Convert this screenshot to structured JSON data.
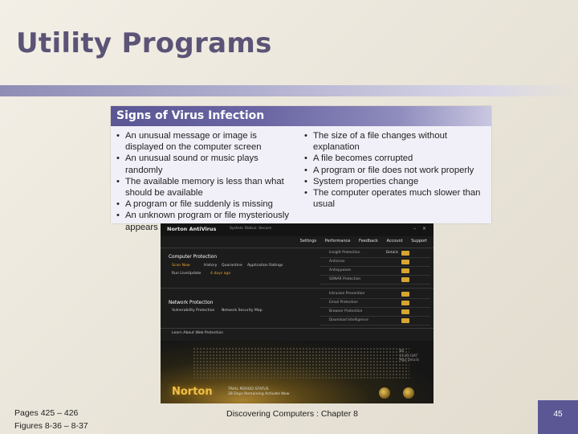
{
  "slide": {
    "title": "Utility Programs",
    "page_ref_line1": "Pages 425 – 426",
    "page_ref_line2": "Figures 8-36 – 8-37",
    "footer_center": "Discovering Computers : Chapter 8",
    "page_number": "45"
  },
  "virus_box": {
    "heading": "Signs of Virus Infection",
    "left_items": [
      "An unusual message or image is displayed on the computer screen",
      "An unusual sound or music plays randomly",
      "The available memory is less than what should be available",
      "A program or file suddenly is missing",
      "An unknown program or file mysteriously appears"
    ],
    "right_items": [
      "The size of a file changes without explanation",
      "A file becomes corrupted",
      "A program or file does not work properly",
      "System properties change",
      "The computer operates much slower than usual"
    ]
  },
  "norton": {
    "logo": "Norton AntiVirus",
    "status": "System Status: Secure",
    "menu": [
      "Settings",
      "Performance",
      "Feedback",
      "Account",
      "Support"
    ],
    "computer_protection": {
      "title": "Computer Protection",
      "links": [
        "Scan Now",
        "History",
        "Quarantine",
        "Application Ratings"
      ],
      "run_live_update": "Run LiveUpdate",
      "days_ago": "4 days ago",
      "rows": [
        "Insight Protection",
        "Antivirus",
        "Antispyware",
        "SONAR Protection"
      ],
      "details_label": "Details"
    },
    "network_protection": {
      "title": "Network Protection",
      "links": [
        "Vulnerability Protection",
        "Network Security Map"
      ],
      "rows": [
        "Intrusion Prevention",
        "Email Protection",
        "Browser Protection",
        "Download Intelligence"
      ]
    },
    "learn_more": "Learn About Web Protection",
    "brand": "Norton",
    "trial_line1": "TRIAL PERIOD STATUS",
    "trial_line2": "28 Days Remaining    Activate Now",
    "corner_line1": "NV",
    "corner_line2": "21:45 GMT",
    "corner_line3": "Map Details"
  }
}
